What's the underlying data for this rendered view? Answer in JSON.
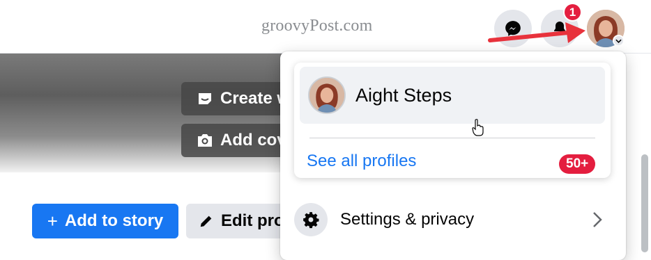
{
  "header": {
    "watermark": "groovyPost.com",
    "notification_count": "1",
    "icons": [
      "messenger-icon",
      "bell-icon",
      "avatar",
      "chevron-down-icon"
    ]
  },
  "annotation": {
    "step_number": "1",
    "color": "#e8323c"
  },
  "cover": {
    "create_label": "Create w",
    "add_cover_label": "Add cov"
  },
  "actions": {
    "add_story_label": "Add to story",
    "edit_profile_label": "Edit pro"
  },
  "menu": {
    "profile_name": "Aight Steps",
    "see_all_label": "See all profiles",
    "profiles_count": "50+",
    "settings_label": "Settings & privacy"
  },
  "colors": {
    "accent": "#1877f2",
    "badge": "#e41e3f",
    "button_bg": "#e4e6eb"
  }
}
